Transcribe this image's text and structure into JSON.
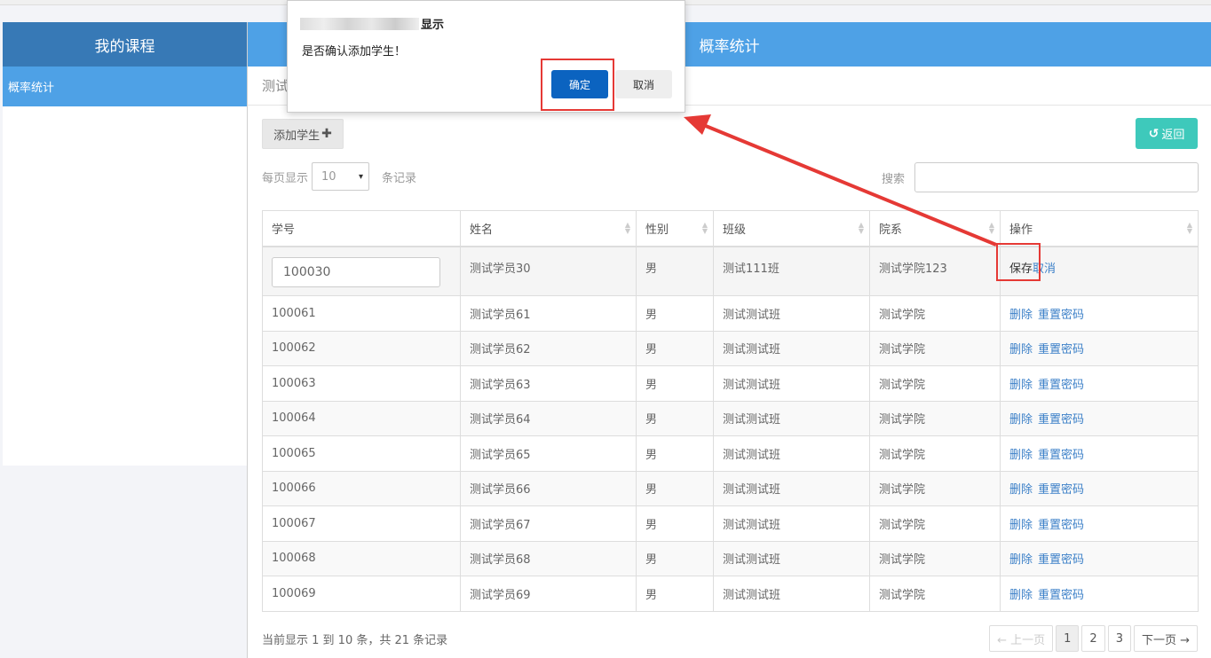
{
  "sidebar": {
    "title": "我的课程",
    "items": [
      {
        "label": "概率统计"
      }
    ]
  },
  "main": {
    "title": "概率统计",
    "breadcrumb": "测试",
    "add_button": "添加学生",
    "back_button": "返回",
    "per_page_prefix": "每页显示",
    "per_page_value": "10",
    "per_page_suffix": "条记录",
    "search_label": "搜索",
    "search_value": ""
  },
  "table": {
    "headers": [
      "学号",
      "姓名",
      "性别",
      "班级",
      "院系",
      "操作"
    ],
    "edit_row": {
      "id": "100030",
      "name": "测试学员30",
      "gender": "男",
      "class": "测试111班",
      "dept": "测试学院123",
      "save": "保存",
      "cancel": "取消"
    },
    "rows": [
      {
        "id": "100061",
        "name": "测试学员61",
        "gender": "男",
        "class": "测试测试班",
        "dept": "测试学院"
      },
      {
        "id": "100062",
        "name": "测试学员62",
        "gender": "男",
        "class": "测试测试班",
        "dept": "测试学院"
      },
      {
        "id": "100063",
        "name": "测试学员63",
        "gender": "男",
        "class": "测试测试班",
        "dept": "测试学院"
      },
      {
        "id": "100064",
        "name": "测试学员64",
        "gender": "男",
        "class": "测试测试班",
        "dept": "测试学院"
      },
      {
        "id": "100065",
        "name": "测试学员65",
        "gender": "男",
        "class": "测试测试班",
        "dept": "测试学院"
      },
      {
        "id": "100066",
        "name": "测试学员66",
        "gender": "男",
        "class": "测试测试班",
        "dept": "测试学院"
      },
      {
        "id": "100067",
        "name": "测试学员67",
        "gender": "男",
        "class": "测试测试班",
        "dept": "测试学院"
      },
      {
        "id": "100068",
        "name": "测试学员68",
        "gender": "男",
        "class": "测试测试班",
        "dept": "测试学院"
      },
      {
        "id": "100069",
        "name": "测试学员69",
        "gender": "男",
        "class": "测试测试班",
        "dept": "测试学院"
      }
    ],
    "delete_label": "删除",
    "reset_label": "重置密码"
  },
  "footer": {
    "info": "当前显示 1 到 10 条，共 21 条记录",
    "prev": "← 上一页",
    "pages": [
      "1",
      "2",
      "3"
    ],
    "next": "下一页 →"
  },
  "dialog": {
    "title_suffix": "显示",
    "message": "是否确认添加学生！",
    "ok": "确定",
    "cancel": "取消"
  },
  "colors": {
    "header_blue": "#4ea1e6",
    "sidebar_dark": "#3779b6",
    "teal": "#3ec9bb",
    "ok_blue": "#0b63c0",
    "highlight_red": "#e53935"
  }
}
